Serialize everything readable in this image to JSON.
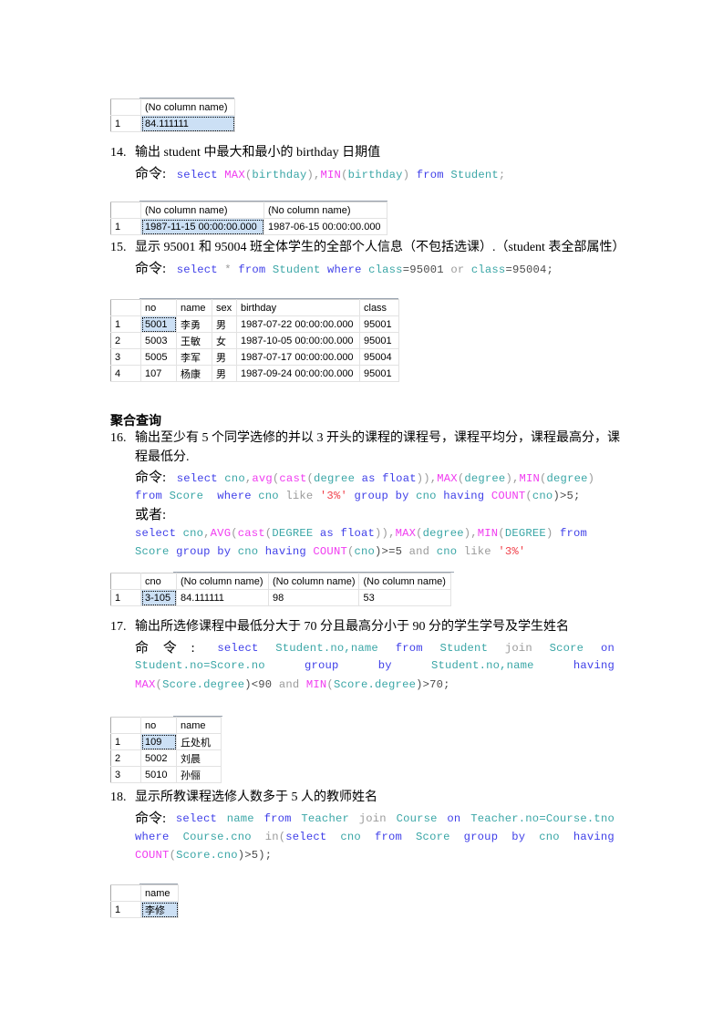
{
  "results": {
    "r13": {
      "headers": [
        "",
        "(No column name)"
      ],
      "rows": [
        [
          "1",
          "84.111111"
        ]
      ]
    },
    "r14": {
      "headers": [
        "",
        "(No column name)",
        "(No column name)"
      ],
      "rows": [
        [
          "1",
          "1987-11-15 00:00:00.000",
          "1987-06-15 00:00:00.000"
        ]
      ]
    },
    "r15": {
      "headers": [
        "",
        "no",
        "name",
        "sex",
        "birthday",
        "class"
      ],
      "rows": [
        [
          "1",
          "5001",
          "李勇",
          "男",
          "1987-07-22 00:00:00.000",
          "95001"
        ],
        [
          "2",
          "5003",
          "王敏",
          "女",
          "1987-10-05 00:00:00.000",
          "95001"
        ],
        [
          "3",
          "5005",
          "李军",
          "男",
          "1987-07-17 00:00:00.000",
          "95004"
        ],
        [
          "4",
          "107",
          "杨康",
          "男",
          "1987-09-24 00:00:00.000",
          "95001"
        ]
      ]
    },
    "r16": {
      "headers": [
        "",
        "cno",
        "(No column name)",
        "(No column name)",
        "(No column name)"
      ],
      "rows": [
        [
          "1",
          "3-105",
          "84.111111",
          "98",
          "53"
        ]
      ]
    },
    "r17": {
      "headers": [
        "",
        "no",
        "name"
      ],
      "rows": [
        [
          "1",
          "109",
          "丘处机"
        ],
        [
          "2",
          "5002",
          "刘晨"
        ],
        [
          "3",
          "5010",
          "孙俪"
        ]
      ]
    },
    "r18": {
      "headers": [
        "",
        "name"
      ],
      "rows": [
        [
          "1",
          "李修"
        ]
      ]
    }
  },
  "questions": {
    "q14": {
      "num": "14.",
      "text": "输出 student 中最大和最小的 birthday 日期值",
      "cmd_label": "命令:",
      "code": [
        "select",
        "MAX",
        "(",
        "birthday",
        "),",
        "MIN",
        "(",
        "birthday",
        ")",
        "from",
        "Student",
        ";"
      ]
    },
    "q15": {
      "num": "15.",
      "text": "显示 95001 和 95004 班全体学生的全部个人信息（不包括选课）.（student 表全部属性）",
      "cmd_label": "命令:",
      "code": [
        "select",
        "*",
        "from",
        "Student",
        "where",
        "class",
        "=95001",
        "or",
        "class",
        "=95004;"
      ]
    },
    "section_heading": "聚合查询",
    "q16": {
      "num": "16.",
      "text_line1": "输出至少有 5 个同学选修的并以 3 开头的课程的课程号，课程平均分，课程最高分，课",
      "text_line2": "程最低分.",
      "cmd_label": "命令:",
      "alt_label": "或者:",
      "code1_line1": [
        "select",
        "cno",
        ",",
        "avg",
        "(",
        "cast",
        "(",
        "degree",
        "as",
        "float",
        ")),",
        "MAX",
        "(",
        "degree",
        "),",
        "MIN",
        "(",
        "degree",
        ")"
      ],
      "code1_line2": [
        "from",
        "Score",
        "where",
        "cno",
        "like",
        "'3%'",
        "group",
        "by",
        "cno",
        "having",
        "COUNT",
        "(",
        "cno",
        ")>5;"
      ],
      "code2_line1": [
        "select",
        "cno",
        ",",
        "AVG",
        "(",
        "cast",
        "(",
        "DEGREE",
        "as",
        "float",
        ")),",
        "MAX",
        "(",
        "degree",
        "),",
        "MIN",
        "(",
        "DEGREE",
        ")",
        "from"
      ],
      "code2_line2": [
        "Score",
        "group",
        "by",
        "cno",
        "having",
        "COUNT",
        "(",
        "cno",
        ")>=5",
        "and",
        "cno",
        "like",
        "'3%'"
      ]
    },
    "q17": {
      "num": "17.",
      "text": "输出所选修课程中最低分大于 70 分且最高分小于 90 分的学生学号及学生姓名",
      "cmd_label": "命 令 :",
      "code_line1": [
        "select",
        "Student.no,name",
        "from",
        "Student",
        "join",
        "Score",
        "on"
      ],
      "code_line2": [
        "Student.no=Score.no",
        "group",
        "by",
        "Student.no,name",
        "having"
      ],
      "code_line3": [
        "MAX",
        "(",
        "Score.degree",
        ")<90",
        "and",
        "MIN",
        "(",
        "Score.degree",
        ")>70;"
      ]
    },
    "q18": {
      "num": "18.",
      "text": "显示所教课程选修人数多于 5 人的教师姓名",
      "cmd_label": "命令:",
      "code_line1": [
        "select",
        "name",
        "from",
        "Teacher",
        "join",
        "Course",
        "on",
        "Teacher.no=Course.tno"
      ],
      "code_line2": [
        "where",
        "Course.cno",
        "in(",
        "select",
        "cno",
        "from",
        "Score",
        "group",
        "by",
        "cno",
        "having"
      ],
      "code_line3": [
        "COUNT",
        "(",
        "Score.cno",
        ")>5);"
      ]
    }
  }
}
